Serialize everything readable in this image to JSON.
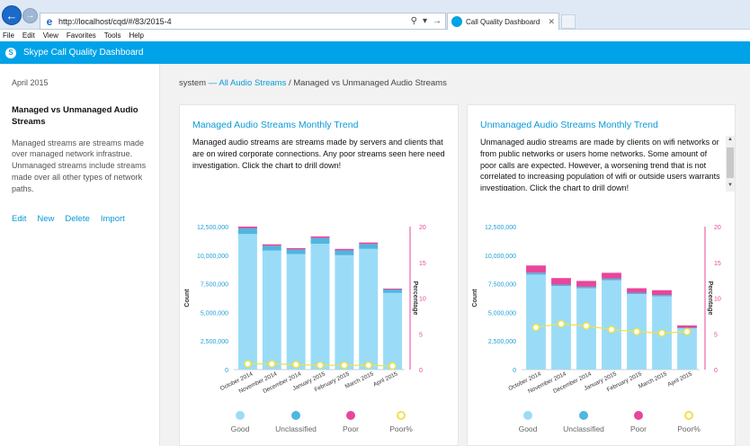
{
  "browser": {
    "url": "http://localhost/cqd/#/83/2015-4",
    "tab_title": "Call Quality Dashboard",
    "menu": [
      "File",
      "Edit",
      "View",
      "Favorites",
      "Tools",
      "Help"
    ]
  },
  "app": {
    "title": "Skype Call Quality Dashboard"
  },
  "sidebar": {
    "period": "April 2015",
    "report_title": "Managed vs Unmanaged Audio Streams",
    "report_desc": "Managed streams are streams made over managed network infrastrue. Unmanaged streams include streams made over all other types of network paths.",
    "actions": [
      "Edit",
      "New",
      "Delete",
      "Import"
    ]
  },
  "breadcrumb": {
    "root": "system",
    "sep1": "—",
    "link": "All Audio Streams",
    "sep2": "/",
    "current": "Managed vs Unmanaged Audio Streams"
  },
  "colors": {
    "good": "#9adcf7",
    "unclassified": "#4fb6de",
    "poor": "#e8469a",
    "poorpct": "#f0e04a",
    "accent": "#0a9ad8",
    "appbar": "#00a2e8"
  },
  "cards": [
    {
      "title": "Managed Audio Streams Monthly Trend",
      "desc": "Managed audio streams are streams made by servers and clients that are on wired corporate connections. Any poor streams seen here need investigation. Click the chart to drill down!"
    },
    {
      "title": "Unmanaged Audio Streams Monthly Trend",
      "desc": "Unmanaged audio streams are made by clients on wifi networks or from public networks or users home networks. Some amount of poor calls are expected. However, a worsening trend that is not correlated to increasing population of wifi or outside users warrants investigation. Click the chart to drill down!"
    }
  ],
  "legend": [
    "Good",
    "Unclassified",
    "Poor",
    "Poor%"
  ],
  "chart_data": [
    {
      "type": "bar",
      "stacked": true,
      "title": "",
      "ylabel": "Count",
      "y2label": "Percentage",
      "ylim": [
        0,
        12500000
      ],
      "y2lim": [
        0,
        20
      ],
      "yticks": [
        "0",
        "2,500,000",
        "5,000,000",
        "7,500,000",
        "10,000,000",
        "12,500,000"
      ],
      "y2ticks": [
        "0",
        "5",
        "10",
        "15",
        "20"
      ],
      "categories": [
        "October 2014",
        "November 2014",
        "December 2014",
        "January 2015",
        "February 2015",
        "March 2015",
        "April 2015"
      ],
      "series": [
        {
          "name": "Good",
          "values": [
            11850000,
            10400000,
            10100000,
            11000000,
            10000000,
            10550000,
            6700000
          ]
        },
        {
          "name": "Unclassified",
          "values": [
            500000,
            420000,
            400000,
            500000,
            420000,
            430000,
            300000
          ]
        },
        {
          "name": "Poor",
          "values": [
            150000,
            130000,
            120000,
            140000,
            130000,
            130000,
            80000
          ]
        }
      ],
      "line": {
        "name": "Poor%",
        "values": [
          0.8,
          0.8,
          0.7,
          0.6,
          0.6,
          0.6,
          0.5
        ]
      }
    },
    {
      "type": "bar",
      "stacked": true,
      "title": "",
      "ylabel": "Count",
      "y2label": "Percentage",
      "ylim": [
        0,
        12500000
      ],
      "y2lim": [
        0,
        20
      ],
      "yticks": [
        "0",
        "2,500,000",
        "5,000,000",
        "7,500,000",
        "10,000,000",
        "12,500,000"
      ],
      "y2ticks": [
        "0",
        "5",
        "10",
        "15",
        "20"
      ],
      "categories": [
        "October 2014",
        "November 2014",
        "December 2014",
        "January 2015",
        "February 2015",
        "March 2015",
        "April 2015"
      ],
      "series": [
        {
          "name": "Good",
          "values": [
            8300000,
            7300000,
            7100000,
            7800000,
            6600000,
            6400000,
            3600000
          ]
        },
        {
          "name": "Unclassified",
          "values": [
            170000,
            130000,
            140000,
            150000,
            120000,
            120000,
            60000
          ]
        },
        {
          "name": "Poor",
          "values": [
            630000,
            570000,
            510000,
            510000,
            390000,
            420000,
            200000
          ]
        }
      ],
      "line": {
        "name": "Poor%",
        "values": [
          5.9,
          6.4,
          6.1,
          5.6,
          5.3,
          5.1,
          5.3
        ]
      }
    }
  ]
}
